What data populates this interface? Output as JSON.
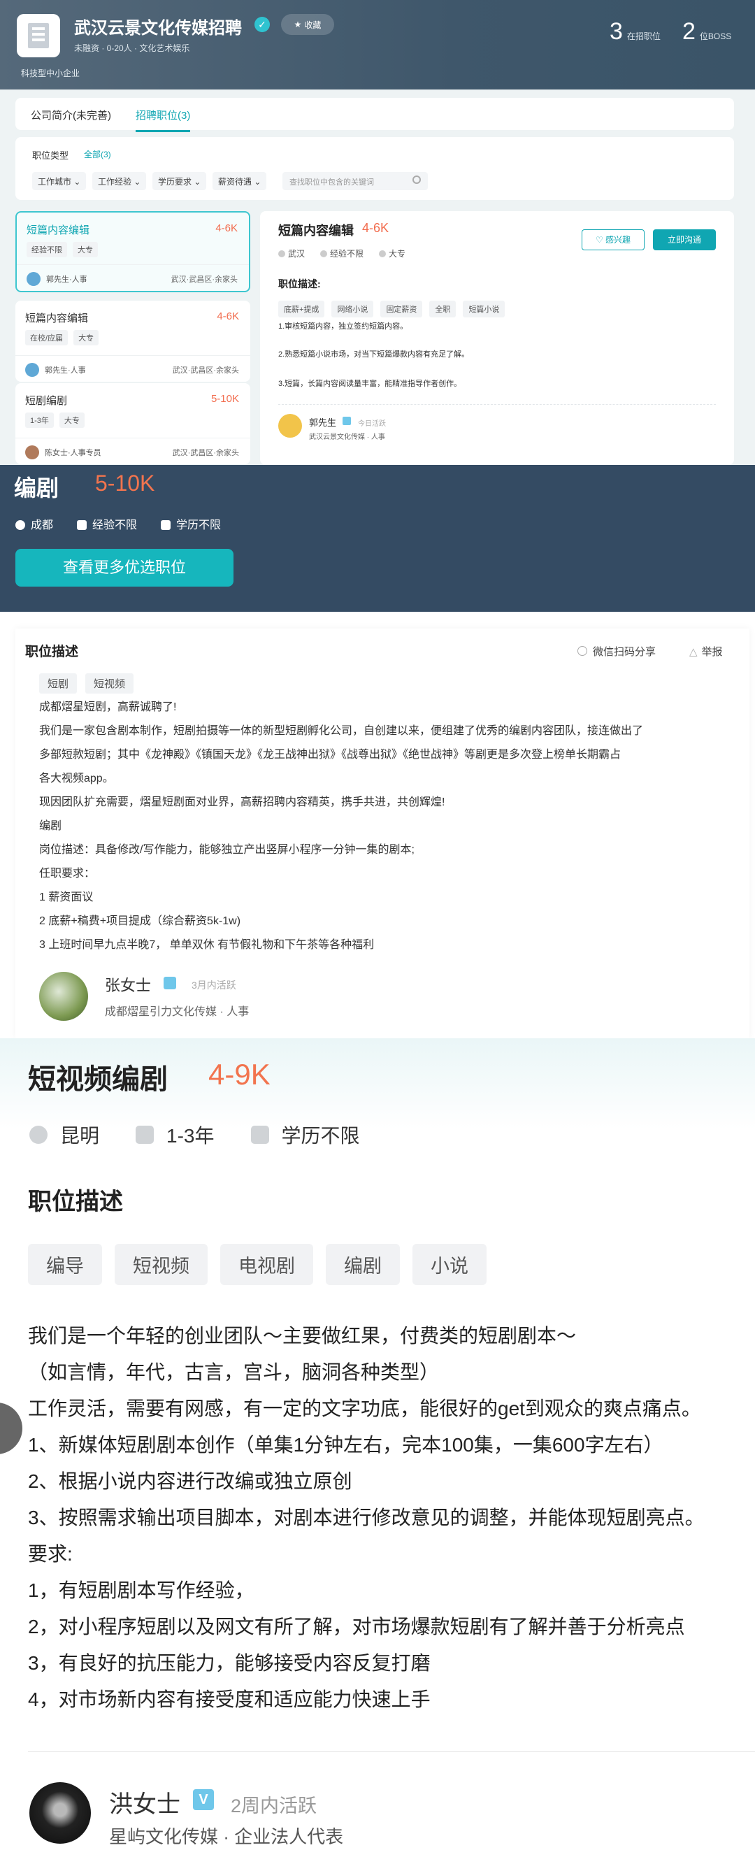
{
  "s1": {
    "company": "武汉云景文化传媒招聘",
    "fav_label": "收藏",
    "meta": "未融资 · 0-20人 · 文化艺术娱乐",
    "tag": "科技型中小企业",
    "stats": [
      {
        "num": "3",
        "label": "在招职位"
      },
      {
        "num": "2",
        "label": "位BOSS"
      }
    ],
    "tabs": [
      "公司简介(未完善)",
      "招聘职位(3)"
    ],
    "filter_label": "职位类型",
    "filter_all": "全部(3)",
    "filters": [
      "工作城市",
      "工作经验",
      "学历要求",
      "薪资待遇"
    ],
    "search_placeholder": "查找职位中包含的关键词",
    "jobs": [
      {
        "title": "短篇内容编辑",
        "salary": "4-6K",
        "tags": [
          "经验不限",
          "大专"
        ],
        "recruiter": "郭先生·人事",
        "location": "武汉·武昌区·余家头"
      },
      {
        "title": "短篇内容编辑",
        "salary": "4-6K",
        "tags": [
          "在校/应届",
          "大专"
        ],
        "recruiter": "郭先生·人事",
        "location": "武汉·武昌区·余家头"
      },
      {
        "title": "短剧编剧",
        "salary": "5-10K",
        "tags": [
          "1-3年",
          "大专"
        ],
        "recruiter": "陈女士·人事专员",
        "location": "武汉·武昌区·余家头"
      }
    ],
    "detail": {
      "title": "短篇内容编辑",
      "salary": "4-6K",
      "meta": [
        "武汉",
        "经验不限",
        "大专"
      ],
      "interest": "感兴趣",
      "chat": "立即沟通",
      "heading": "职位描述:",
      "tags": [
        "底薪+提成",
        "网络小说",
        "固定薪资",
        "全职",
        "短篇小说"
      ],
      "lines": [
        "1.审核短篇内容，独立签约短篇内容。",
        "2.熟悉短篇小说市场，对当下短篇爆款内容有充足了解。",
        "3.短篇，长篇内容阅读量丰富，能精准指导作者创作。"
      ],
      "name": "郭先生",
      "active": "今日活跃",
      "company": "武汉云景文化传媒 · 人事"
    }
  },
  "s2": {
    "title": "编剧",
    "salary": "5-10K",
    "meta": [
      "成都",
      "经验不限",
      "学历不限"
    ],
    "button": "查看更多优选职位"
  },
  "s3": {
    "heading": "职位描述",
    "share": "微信扫码分享",
    "report": "举报",
    "tags": [
      "短剧",
      "短视频"
    ],
    "lines": [
      "成都熠星短剧，高薪诚聘了!",
      "我们是一家包含剧本制作，短剧拍摄等一体的新型短剧孵化公司，自创建以来，便组建了优秀的编剧内容团队，接连做出了",
      "多部短款短剧；其中《龙神殿》《镇国天龙》《龙王战神出狱》《战尊出狱》《绝世战神》等剧更是多次登上榜单长期霸占",
      "各大视频app。",
      "现因团队扩充需要，熠星短剧面对业界，高薪招聘内容精英，携手共进，共创辉煌!",
      "编剧",
      "岗位描述：具备修改/写作能力，能够独立产出竖屏小程序一分钟一集的剧本;",
      "任职要求：",
      "1 薪资面议",
      "2 底薪+稿费+项目提成（综合薪资5k-1w)",
      "3 上班时间早九点半晚7， 单单双休 有节假礼物和下午茶等各种福利"
    ],
    "name": "张女士",
    "active": "3月内活跃",
    "company": "成都熠星引力文化传媒 · 人事"
  },
  "s4": {
    "title": "短视频编剧",
    "salary": "4-9K",
    "meta": [
      "昆明",
      "1-3年",
      "学历不限"
    ],
    "heading": "职位描述",
    "tags": [
      "编导",
      "短视频",
      "电视剧",
      "编剧",
      "小说"
    ],
    "lines": [
      "我们是一个年轻的创业团队～主要做红果，付费类的短剧剧本～",
      "（如言情，年代，古言，宫斗，脑洞各种类型）",
      "工作灵活，需要有网感，有一定的文字功底，能很好的get到观众的爽点痛点。",
      "1、新媒体短剧剧本创作（单集1分钟左右，完本100集，一集600字左右）",
      "2、根据小说内容进行改编或独立原创",
      "3、按照需求输出项目脚本，对剧本进行修改意见的调整，并能体现短剧亮点。",
      "要求:",
      "1，有短剧剧本写作经验，",
      "2，对小程序短剧以及网文有所了解，对市场爆款短剧有了解并善于分析亮点",
      "3，有良好的抗压能力，能够接受内容反复打磨",
      "4，对市场新内容有接受度和适应能力快速上手"
    ],
    "name": "洪女士",
    "verify": "V",
    "active": "2周内活跃",
    "company": "星屿文化传媒 · 企业法人代表"
  }
}
